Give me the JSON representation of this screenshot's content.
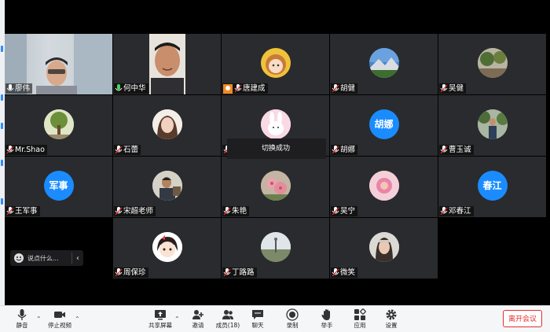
{
  "participants": [
    {
      "name": "廖伟",
      "avatar": "video-feed",
      "col": 0,
      "row": 0
    },
    {
      "name": "何中华",
      "avatar": "video-feed",
      "col": 1,
      "row": 0
    },
    {
      "name": "唐建成",
      "avatar": "cartoon-girl-photo",
      "col": 2,
      "row": 0
    },
    {
      "name": "胡健",
      "avatar": "mountain-photo",
      "col": 3,
      "row": 0
    },
    {
      "name": "吴健",
      "avatar": "garden-photo",
      "col": 4,
      "row": 0
    },
    {
      "name": "Mr.Shao",
      "avatar": "tree-photo",
      "col": 0,
      "row": 1
    },
    {
      "name": "石蕾",
      "avatar": "selfie-photo",
      "col": 1,
      "row": 1
    },
    {
      "name": "",
      "avatar": "cartoon-bunny-photo",
      "col": 2,
      "row": 1
    },
    {
      "name": "胡娜",
      "avatar": "text-avatar",
      "avatar_text": "胡娜",
      "col": 3,
      "row": 1
    },
    {
      "name": "曹玉诚",
      "avatar": "person-outdoor-photo",
      "col": 4,
      "row": 1
    },
    {
      "name": "王军事",
      "avatar": "text-avatar",
      "avatar_text": "军事",
      "col": 0,
      "row": 2
    },
    {
      "name": "宋超老师",
      "avatar": "teacher-photo",
      "col": 1,
      "row": 2
    },
    {
      "name": "朱艳",
      "avatar": "flower-photo",
      "col": 2,
      "row": 2
    },
    {
      "name": "吴宁",
      "avatar": "pink-flower-photo",
      "col": 3,
      "row": 2
    },
    {
      "name": "邓春江",
      "avatar": "text-avatar",
      "avatar_text": "春江",
      "col": 4,
      "row": 2
    },
    {
      "name": "周保珍",
      "avatar": "cartoon-face-photo",
      "col": 1,
      "row": 3
    },
    {
      "name": "丁路路",
      "avatar": "landscape-photo",
      "col": 2,
      "row": 3
    },
    {
      "name": "微笑",
      "avatar": "portrait-photo",
      "col": 3,
      "row": 3
    }
  ],
  "toast": {
    "text": "切换成功"
  },
  "chat": {
    "placeholder": "说点什么..."
  },
  "toolbar": {
    "mute": "静音",
    "stop_video": "停止视频",
    "share_screen": "共享屏幕",
    "invite": "邀请",
    "participants": "成员(18)",
    "chat": "聊天",
    "record": "录制",
    "raise_hand": "举手",
    "apps": "应用",
    "settings": "设置",
    "leave": "离开会议"
  },
  "colors": {
    "accent": "#1a8cff",
    "active_speaker": "#2fb34a",
    "leave": "#e0302c",
    "host": "#f08a1e",
    "tile": "#2a2b2e"
  }
}
